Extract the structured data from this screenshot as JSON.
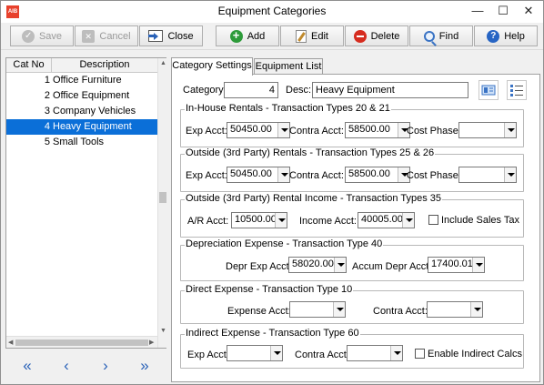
{
  "window": {
    "title": "Equipment Categories",
    "app_icon_text": "AIB",
    "minimize_glyph": "—",
    "maximize_glyph": "☐",
    "close_glyph": "✕"
  },
  "toolbar": {
    "save": "Save",
    "cancel": "Cancel",
    "close": "Close",
    "add": "Add",
    "edit": "Edit",
    "delete": "Delete",
    "find": "Find",
    "help": "Help"
  },
  "list": {
    "col_no": "Cat No",
    "col_desc": "Description",
    "rows": [
      {
        "no": "1",
        "desc": "Office Furniture"
      },
      {
        "no": "2",
        "desc": "Office Equipment"
      },
      {
        "no": "3",
        "desc": "Company Vehicles"
      },
      {
        "no": "4",
        "desc": "Heavy Equipment"
      },
      {
        "no": "5",
        "desc": "Small Tools"
      }
    ],
    "selected_index": 3
  },
  "nav": {
    "first": "«",
    "prev": "‹",
    "next": "›",
    "last": "»"
  },
  "tabs": {
    "settings": "Category Settings",
    "equipment": "Equipment List"
  },
  "form": {
    "category_label": "Category:",
    "category_value": "4",
    "desc_label": "Desc:",
    "desc_value": "Heavy Equipment",
    "inhouse": {
      "title": "In-House Rentals - Transaction Types 20 & 21",
      "exp_label": "Exp Acct:",
      "exp_value": "50450.00",
      "contra_label": "Contra Acct:",
      "contra_value": "58500.00",
      "phase_label": "Cost Phase:",
      "phase_value": ""
    },
    "outside": {
      "title": "Outside (3rd Party)  Rentals - Transaction Types 25 & 26",
      "exp_label": "Exp Acct:",
      "exp_value": "50450.00",
      "contra_label": "Contra Acct:",
      "contra_value": "58500.00",
      "phase_label": "Cost Phase:",
      "phase_value": ""
    },
    "income": {
      "title": "Outside (3rd Party)  Rental Income - Transaction Types 35",
      "ar_label": "A/R Acct:",
      "ar_value": "10500.00",
      "income_label": "Income Acct:",
      "income_value": "40005.00",
      "tax_label": "Include Sales Tax"
    },
    "depreciation": {
      "title": "Depreciation Expense - Transaction Type 40",
      "exp_label": "Depr Exp Acct:",
      "exp_value": "58020.00",
      "accum_label": "Accum Depr Acct:",
      "accum_value": "17400.01"
    },
    "direct": {
      "title": "Direct Expense - Transaction Type 10",
      "exp_label": "Expense Acct:",
      "exp_value": "",
      "contra_label": "Contra Acct:",
      "contra_value": ""
    },
    "indirect": {
      "title": "Indirect Expense - Transaction Type 60",
      "exp_label": "Exp Acct:",
      "exp_value": "",
      "contra_label": "Contra Acct:",
      "contra_value": "",
      "enable_label": "Enable Indirect Calcs"
    }
  }
}
